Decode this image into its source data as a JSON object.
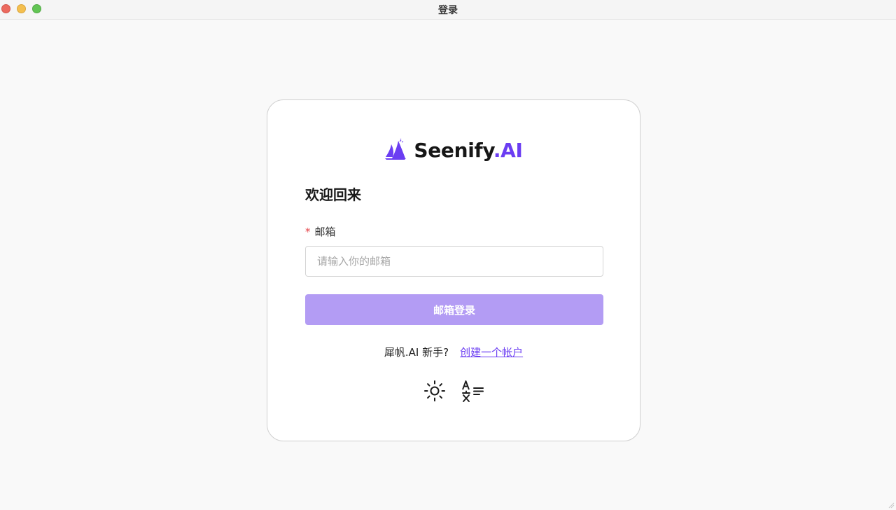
{
  "window": {
    "title": "登录"
  },
  "brand": {
    "name_main": "Seenify",
    "name_accent": ".AI",
    "logo_icon": "sailboat-logo-icon",
    "accent_color": "#6b3df2"
  },
  "login": {
    "heading": "欢迎回来",
    "email_label": "邮箱",
    "required_marker": "*",
    "email_placeholder": "请输入你的邮箱",
    "email_value": "",
    "submit_label": "邮箱登录",
    "submit_color": "#b39cf4"
  },
  "signup": {
    "prompt": "犀帆.AI 新手?",
    "link_label": "创建一个帐户"
  },
  "tools": [
    {
      "icon": "sun-icon",
      "purpose": "theme-toggle"
    },
    {
      "icon": "translate-icon",
      "purpose": "language-switch"
    }
  ]
}
